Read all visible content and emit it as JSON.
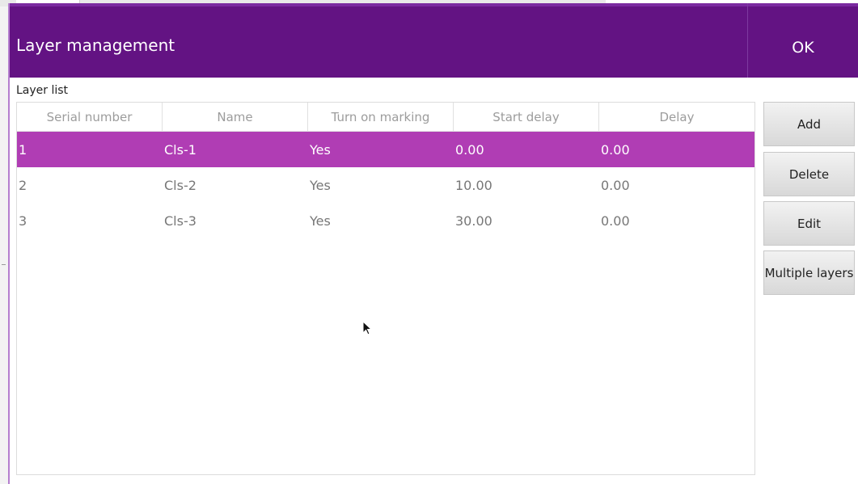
{
  "dialog": {
    "title": "Layer management",
    "ok_label": "OK",
    "section_label": "Layer list"
  },
  "table": {
    "columns": [
      "Serial number",
      "Name",
      "Turn on marking",
      "Start delay",
      "Delay"
    ],
    "rows": [
      {
        "serial": "1",
        "name": "Cls-1",
        "marking": "Yes",
        "start_delay": "0.00",
        "delay": "0.00",
        "selected": true
      },
      {
        "serial": "2",
        "name": "Cls-2",
        "marking": "Yes",
        "start_delay": "10.00",
        "delay": "0.00",
        "selected": false
      },
      {
        "serial": "3",
        "name": "Cls-3",
        "marking": "Yes",
        "start_delay": "30.00",
        "delay": "0.00",
        "selected": false
      }
    ]
  },
  "buttons": {
    "add": "Add",
    "delete": "Delete",
    "edit": "Edit",
    "multiple_layers": "Multiple layers"
  },
  "colors": {
    "title_bar": "#631383",
    "selected_row": "#b03db4"
  },
  "icons": {
    "cursor": "mouse-pointer-icon"
  }
}
